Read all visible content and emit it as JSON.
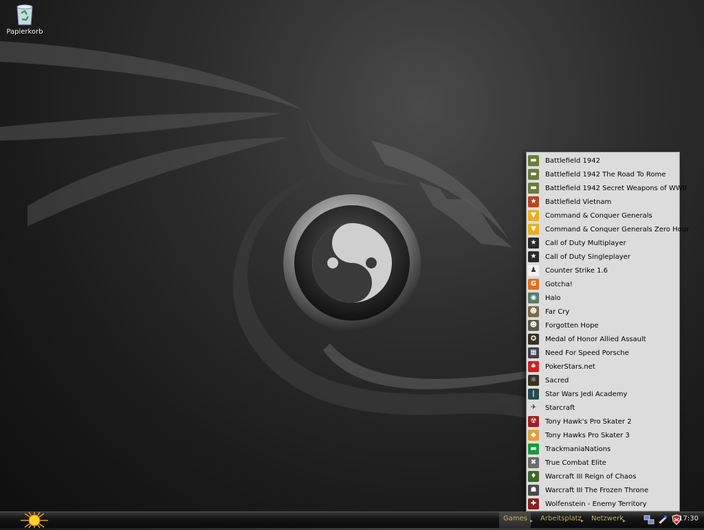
{
  "desktop": {
    "icons": [
      {
        "label": "Papierkorb",
        "icon": "recycle-bin-icon"
      }
    ]
  },
  "games_menu": {
    "items": [
      {
        "label": "Battlefield 1942",
        "icon": "tank-icon",
        "color": "#6b7b3a"
      },
      {
        "label": "Battlefield 1942 The Road To Rome",
        "icon": "tank-icon",
        "color": "#6b7b3a"
      },
      {
        "label": "Battlefield 1942 Secret Weapons of WWII",
        "icon": "tank-icon",
        "color": "#6b7b3a"
      },
      {
        "label": "Battlefield Vietnam",
        "icon": "star-icon",
        "color": "#b5461f"
      },
      {
        "label": "Command & Conquer Generals",
        "icon": "generals-icon",
        "color": "#e8b020"
      },
      {
        "label": "Command & Conquer Generals Zero Hour",
        "icon": "generals-icon",
        "color": "#e8b020"
      },
      {
        "label": "Call of Duty Multiplayer",
        "icon": "cod-star-icon",
        "color": "#2a2a2a"
      },
      {
        "label": "Call of Duty Singleplayer",
        "icon": "cod-star-icon",
        "color": "#2a2a2a"
      },
      {
        "label": "Counter Strike 1.6",
        "icon": "soldier-icon",
        "color": "#f2f2f2"
      },
      {
        "label": "Gotcha!",
        "icon": "gotcha-icon",
        "color": "#e07020"
      },
      {
        "label": "Halo",
        "icon": "helmet-icon",
        "color": "#5a7a6a"
      },
      {
        "label": "Far Cry",
        "icon": "face-icon",
        "color": "#7a6a4a"
      },
      {
        "label": "Forgotten Hope",
        "icon": "soldier-helmet-icon",
        "color": "#5a5a4a"
      },
      {
        "label": "Medal of Honor Allied Assault",
        "icon": "medal-icon",
        "color": "#3a3020"
      },
      {
        "label": "Need For Speed Porsche",
        "icon": "nfs-icon",
        "color": "#404050"
      },
      {
        "label": "PokerStars.net",
        "icon": "spade-icon",
        "color": "#d02020"
      },
      {
        "label": "Sacred",
        "icon": "sacred-icon",
        "color": "#3a3020"
      },
      {
        "label": "Star Wars Jedi Academy",
        "icon": "jedi-icon",
        "color": "#2a4a4a"
      },
      {
        "label": "Starcraft",
        "icon": "starcraft-icon",
        "color": "#dcdcdc"
      },
      {
        "label": "Tony Hawk's Pro Skater 2",
        "icon": "skater-icon",
        "color": "#a02020"
      },
      {
        "label": "Tony Hawks Pro Skater 3",
        "icon": "skater-badge-icon",
        "color": "#e0a040"
      },
      {
        "label": "TrackmaniaNations",
        "icon": "trackmania-icon",
        "color": "#1a9a3a"
      },
      {
        "label": "True Combat Elite",
        "icon": "tce-icon",
        "color": "#6a6a6a"
      },
      {
        "label": "Warcraft III Reign of Chaos",
        "icon": "warcraft-icon",
        "color": "#3a6a2a"
      },
      {
        "label": "Warcraft III The Frozen Throne",
        "icon": "frozen-throne-icon",
        "color": "#4a4a4a"
      },
      {
        "label": "Wolfenstein - Enemy Territory",
        "icon": "wolfenstein-icon",
        "color": "#8a2020"
      }
    ]
  },
  "taskbar": {
    "start_icon": "sun-icon",
    "toolbars": [
      {
        "label": "Games",
        "active": true
      },
      {
        "label": "Arbeitsplatz",
        "active": false
      },
      {
        "label": "Netzwerk",
        "active": false
      }
    ],
    "tray_icons": [
      "network-icon",
      "usb-icon",
      "security-shield-icon"
    ],
    "clock": "17:30"
  }
}
